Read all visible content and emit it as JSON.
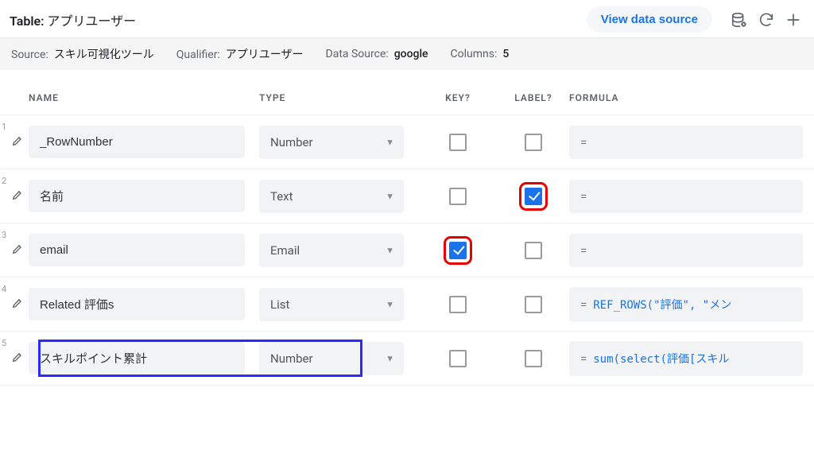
{
  "header": {
    "table_prefix": "Table:",
    "table_name": "アプリユーザー",
    "view_data_source_label": "View data source"
  },
  "subheader": {
    "source_label": "Source:",
    "source_value": "スキル可視化ツール",
    "qualifier_label": "Qualifier:",
    "qualifier_value": "アプリユーザー",
    "datasource_label": "Data Source:",
    "datasource_value": "google",
    "columns_label": "Columns:",
    "columns_value": "5"
  },
  "columns_header": {
    "name": "NAME",
    "type": "TYPE",
    "key": "KEY?",
    "label": "LABEL?",
    "formula": "FORMULA"
  },
  "rows": [
    {
      "index": "1",
      "name": "_RowNumber",
      "type": "Number",
      "key": false,
      "label": false,
      "formula": "",
      "key_hl": false,
      "label_hl": false,
      "blue_box": false
    },
    {
      "index": "2",
      "name": "名前",
      "type": "Text",
      "key": false,
      "label": true,
      "formula": "",
      "key_hl": false,
      "label_hl": true,
      "blue_box": false
    },
    {
      "index": "3",
      "name": "email",
      "type": "Email",
      "key": true,
      "label": false,
      "formula": "",
      "key_hl": true,
      "label_hl": false,
      "blue_box": false
    },
    {
      "index": "4",
      "name": "Related 評価s",
      "type": "List",
      "key": false,
      "label": false,
      "formula": "REF_ROWS(\"評価\", \"メン",
      "key_hl": false,
      "label_hl": false,
      "blue_box": false
    },
    {
      "index": "5",
      "name": "スキルポイント累計",
      "type": "Number",
      "key": false,
      "label": false,
      "formula": "sum(select(評価[スキル",
      "key_hl": false,
      "label_hl": false,
      "blue_box": true
    }
  ]
}
